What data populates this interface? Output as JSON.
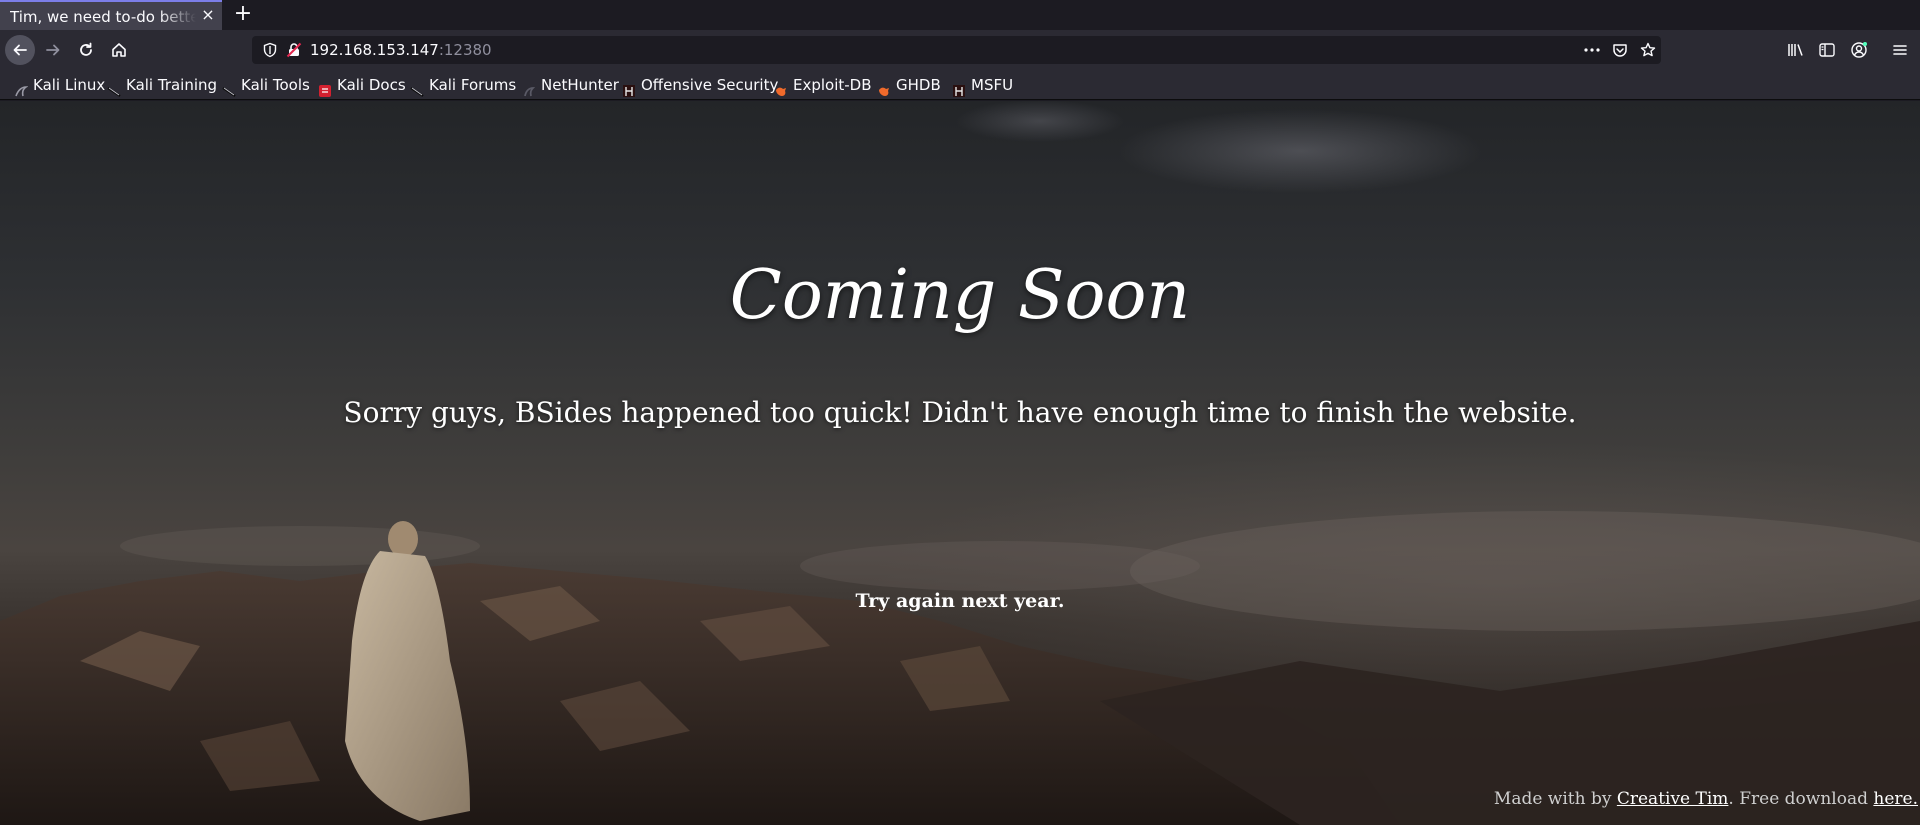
{
  "browser": {
    "tab": {
      "title": "Tim, we need to-do better ne",
      "close_glyph": "×"
    },
    "new_tab_glyph": "+",
    "url": {
      "host": "192.168.153.147",
      "port": ":12380"
    },
    "bookmarks": [
      {
        "label": "Kali Linux",
        "icon": "kali-dragon-icon"
      },
      {
        "label": "Kali Training",
        "icon": "kali-dragon-icon"
      },
      {
        "label": "Kali Tools",
        "icon": "kali-dragon-icon"
      },
      {
        "label": "Kali Docs",
        "icon": "kali-docs-icon"
      },
      {
        "label": "Kali Forums",
        "icon": "kali-dragon-icon"
      },
      {
        "label": "NetHunter",
        "icon": "nethunter-icon"
      },
      {
        "label": "Offensive Security",
        "icon": "offsec-icon"
      },
      {
        "label": "Exploit-DB",
        "icon": "exploitdb-icon"
      },
      {
        "label": "GHDB",
        "icon": "exploitdb-icon"
      },
      {
        "label": "MSFU",
        "icon": "offsec-icon"
      }
    ]
  },
  "page": {
    "headline": "Coming Soon",
    "subline": "Sorry guys, BSides happened too quick! Didn't have enough time to finish the website.",
    "try_again": "Try again next year.",
    "footer": {
      "prefix": "Made with by ",
      "author_link": "Creative Tim",
      "middle": ". Free download ",
      "download_link": "here."
    }
  },
  "colors": {
    "chrome_dark": "#1c1b22",
    "chrome": "#2b2a33",
    "tab_active": "#42414d",
    "text": "#fbfbfe"
  }
}
